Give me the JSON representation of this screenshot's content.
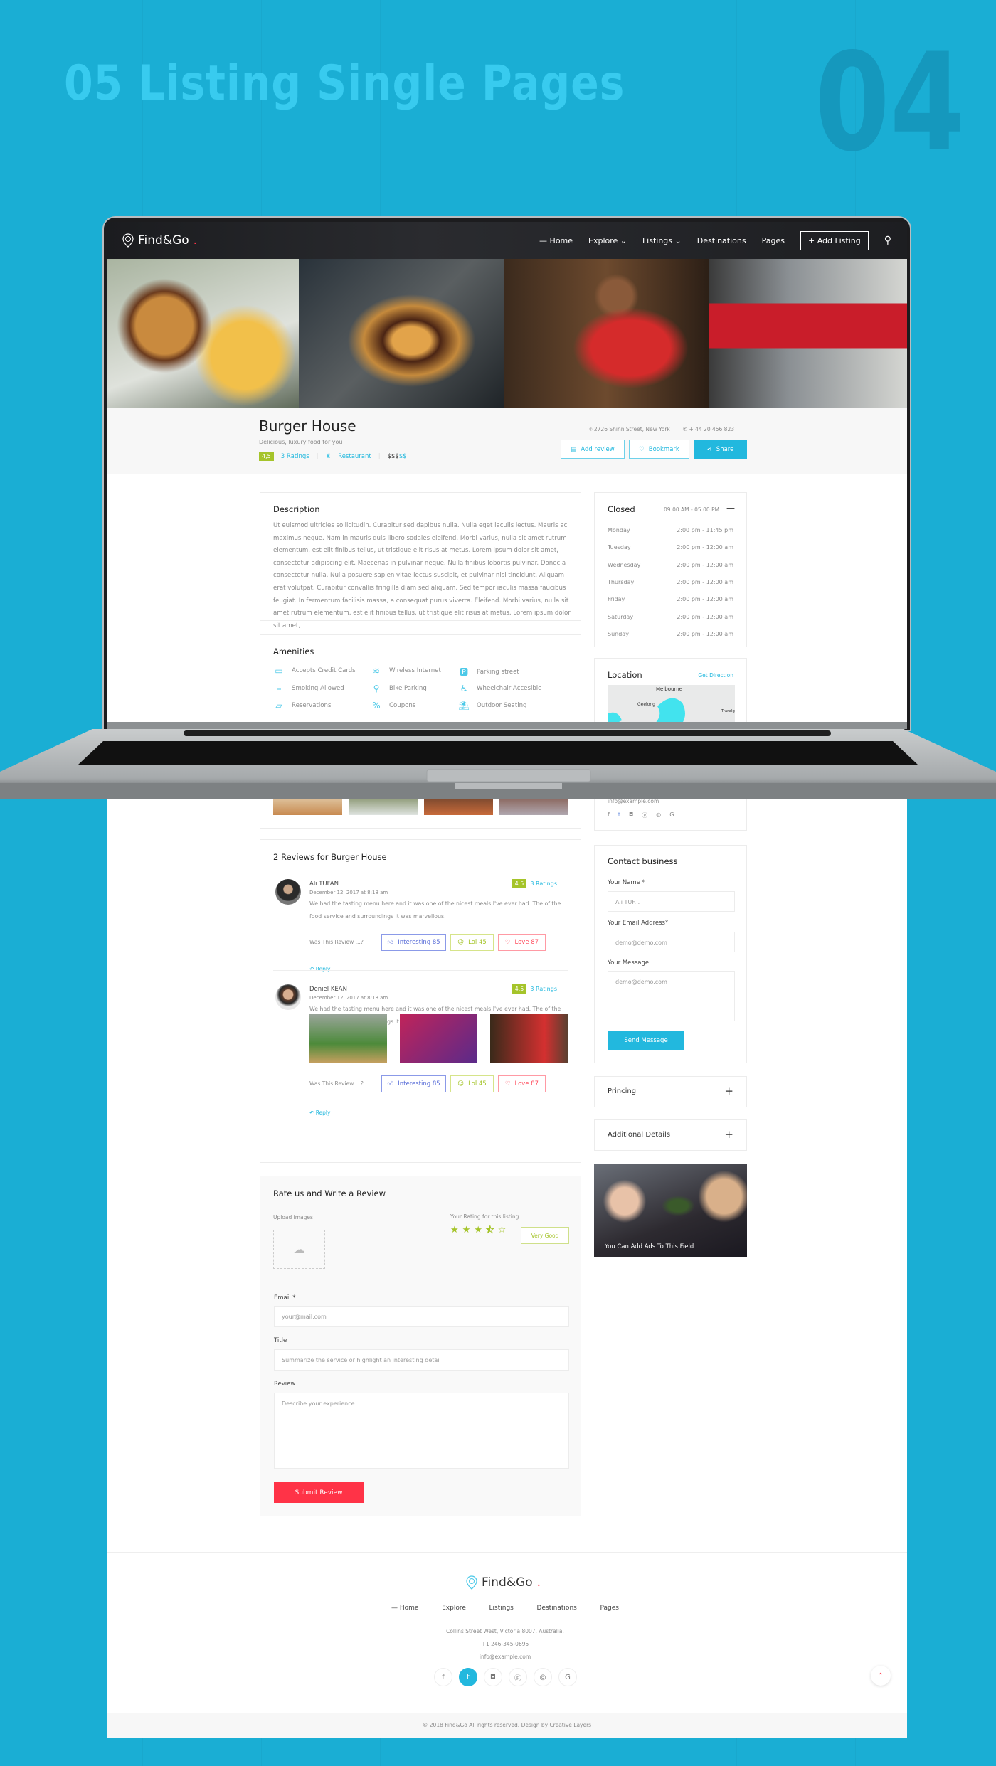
{
  "showcase": {
    "title": "05 Listing Single Pages",
    "number": "04"
  },
  "header": {
    "brand": "Find&Go",
    "nav": [
      "Home",
      "Explore",
      "Listings",
      "Destinations",
      "Pages"
    ],
    "add_listing": "Add Listing"
  },
  "listing": {
    "title": "Burger House",
    "tagline": "Delicious, luxury food for you",
    "rating": "4,5",
    "ratings_label": "3 Ratings",
    "category": "Restaurant",
    "price_active": "$$$",
    "price_inactive": "$$",
    "address": "2726 Shinn Street, New York",
    "phone": "+ 44 20 456 823",
    "actions": {
      "add_review": "Add review",
      "bookmark": "Bookmark",
      "share": "Share"
    }
  },
  "description": {
    "heading": "Description",
    "text": "Ut euismod ultricies sollicitudin. Curabitur sed dapibus nulla. Nulla eget iaculis lectus. Mauris ac maximus neque. Nam in mauris quis libero sodales eleifend. Morbi varius, nulla sit amet rutrum elementum, est elit finibus tellus, ut tristique elit risus at metus. Lorem ipsum dolor sit amet, consectetur adipiscing elit. Maecenas in pulvinar neque. Nulla finibus lobortis pulvinar. Donec a consectetur nulla. Nulla posuere sapien vitae lectus suscipit, et pulvinar nisi tincidunt. Aliquam erat volutpat. Curabitur convallis fringilla diam sed aliquam. Sed tempor iaculis massa faucibus feugiat. In fermentum facilisis massa, a consequat purus viverra. Eleifend. Morbi varius, nulla sit amet rutrum elementum, est elit finibus tellus, ut tristique elit risus at metus. Lorem ipsum dolor sit amet,"
  },
  "amenities": {
    "heading": "Amenities",
    "items": [
      {
        "label": "Accepts Credit Cards",
        "icon": "credit-card-icon"
      },
      {
        "label": "Wireless Internet",
        "icon": "wifi-icon"
      },
      {
        "label": "Parking street",
        "icon": "parking-icon"
      },
      {
        "label": "Smoking Allowed",
        "icon": "cigarette-icon"
      },
      {
        "label": "Bike Parking",
        "icon": "bike-icon"
      },
      {
        "label": "Wheelchair Accesible",
        "icon": "wheelchair-icon"
      },
      {
        "label": "Reservations",
        "icon": "ticket-icon"
      },
      {
        "label": "Coupons",
        "icon": "coupon-icon"
      },
      {
        "label": "Outdoor Seating",
        "icon": "outdoor-icon"
      }
    ]
  },
  "hours": {
    "status": "Closed",
    "range": "09:00 AM - 05:00 PM",
    "days": [
      {
        "day": "Monday",
        "time": "2:00 pm - 11:45 pm"
      },
      {
        "day": "Tuesday",
        "time": "2:00 pm - 12:00 am"
      },
      {
        "day": "Wednesday",
        "time": "2:00 pm - 12:00 am"
      },
      {
        "day": "Thursday",
        "time": "2:00 pm - 12:00 am"
      },
      {
        "day": "Friday",
        "time": "2:00 pm - 12:00 am"
      },
      {
        "day": "Saturday",
        "time": "2:00 pm - 12:00 am"
      },
      {
        "day": "Sunday",
        "time": "2:00 pm - 12:00 am"
      }
    ]
  },
  "location": {
    "heading": "Location",
    "link": "Get Direction",
    "map_labels": [
      "Melbourne",
      "Geelong",
      "Traralg"
    ]
  },
  "contact_info": {
    "email": "info@example.com"
  },
  "reviews": {
    "heading": "2 Reviews for Burger House",
    "was_label": "Was This Review ...?",
    "reply": "Reply",
    "items": [
      {
        "name": "Ali TUFAN",
        "date": "December 12, 2017 at 8:18 am",
        "rating": "4.5",
        "ratings_label": "3 Ratings",
        "text": "We had the tasting menu here and it was one of the nicest meals I've ever had. The of the food service and surroundings it was marvellous.",
        "interesting": "Interesting 85",
        "lol": "Lol 45",
        "love": "Love 87"
      },
      {
        "name": "Deniel KEAN",
        "date": "December 12, 2017 at 8:18 am",
        "rating": "4.5",
        "ratings_label": "3 Ratings",
        "text": "We had the tasting menu here and it was one of the nicest meals I've ever had. The of the food service and surroundings it was marvellous.",
        "interesting": "Interesting 85",
        "lol": "Lol 45",
        "love": "Love 87"
      }
    ]
  },
  "contact_business": {
    "heading": "Contact business",
    "name_label": "Your Name *",
    "name_value": "Ali TUF...",
    "email_label": "Your Email Address*",
    "email_value": "demo@demo.com",
    "message_label": "Your Message",
    "message_value": "demo@demo.com",
    "send": "Send Message"
  },
  "accordions": {
    "pricing": "Princing",
    "additional": "Additional Details"
  },
  "ad": {
    "caption": "You Can Add Ads To This Field"
  },
  "write_review": {
    "heading": "Rate us and Write a Review",
    "upload_label": "Upload images",
    "rating_label": "Your Rating for this listing",
    "rating_value": 3.5,
    "rating_max": 5,
    "rating_text": "Very Good",
    "email_label": "Email *",
    "email_placeholder": "your@mail.com",
    "title_label": "Title",
    "title_placeholder": "Summarize the service or highlight an interesting detail",
    "review_label": "Review",
    "review_placeholder": "Describe your experience",
    "submit": "Submit Review"
  },
  "footer": {
    "brand": "Find&Go",
    "nav": [
      "Home",
      "Explore",
      "Listings",
      "Destinations",
      "Pages"
    ],
    "address": "Collins Street West, Victoria 8007, Australia.",
    "phone": "+1 246-345-0695",
    "email": "info@example.com",
    "copyright": "© 2018 Find&Go All rights reserved. Design by Creative Layers"
  },
  "colors": {
    "background": "#1aaed4",
    "accent": "#22b8de",
    "rating": "#a5c42a",
    "submit": "#ff3347",
    "interesting": "#6b7fe0",
    "love": "#ff6b7a"
  }
}
